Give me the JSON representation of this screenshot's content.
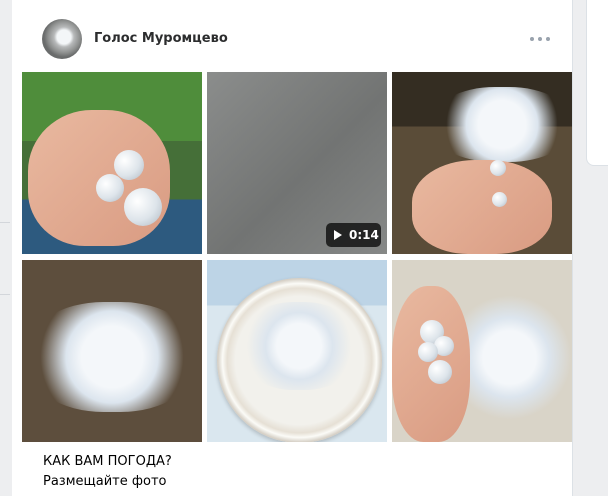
{
  "post": {
    "author_name": "Голос Муромцево",
    "media": [
      {
        "type": "photo",
        "label": "hailstones-in-hand"
      },
      {
        "type": "video",
        "duration": "0:14"
      },
      {
        "type": "photo",
        "label": "hail-on-ground-and-palm"
      },
      {
        "type": "photo",
        "label": "hail-on-soil"
      },
      {
        "type": "photo",
        "label": "hail-on-plate"
      },
      {
        "type": "photo",
        "label": "hail-on-floor-and-hand"
      }
    ],
    "text_lines": [
      "КАК ВАМ ПОГОДА?",
      "Размещайте фото"
    ]
  },
  "icons": {
    "more": "more-horizontal-icon",
    "play": "play-icon"
  },
  "colors": {
    "page_bg": "#edeef0",
    "card_bg": "#ffffff",
    "text": "#2c2d2e",
    "muted": "#99a2ad"
  }
}
